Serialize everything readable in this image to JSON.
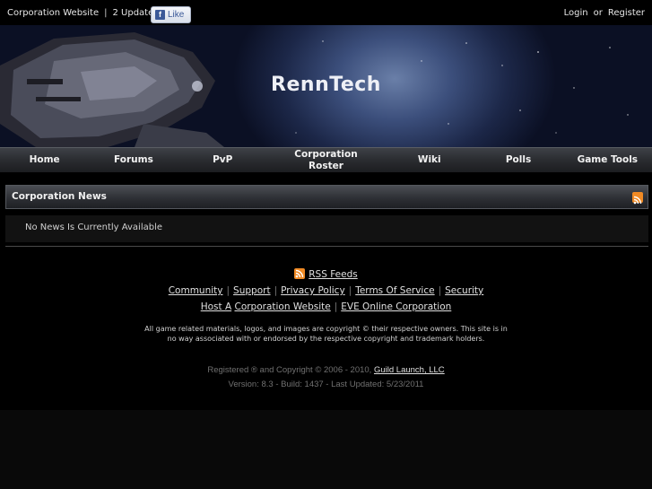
{
  "topbar": {
    "corp_website": "Corporation Website",
    "separator": "|",
    "updates": "2 Updates",
    "fb_like": "Like",
    "fb_icon_glyph": "f",
    "login": "Login",
    "or": "or",
    "register": "Register"
  },
  "banner": {
    "title": "RennTech"
  },
  "nav": {
    "items": [
      {
        "label": "Home"
      },
      {
        "label": "Forums"
      },
      {
        "label": "PvP"
      },
      {
        "label": "Corporation Roster"
      },
      {
        "label": "Wiki"
      },
      {
        "label": "Polls"
      },
      {
        "label": "Game Tools"
      }
    ]
  },
  "news": {
    "title": "Corporation News",
    "empty_message": "No News Is Currently Available"
  },
  "footer": {
    "rss_feeds": "RSS Feeds",
    "links_row1": [
      "Community",
      "Support",
      "Privacy Policy",
      "Terms Of Service",
      "Security"
    ],
    "host_a": "Host A",
    "corp_website": "Corporation Website",
    "eve_corp": "EVE Online Corporation",
    "copyright_notice": "All game related materials, logos, and images are copyright © their respective owners. This site is in no way associated with or endorsed by the respective copyright and trademark holders.",
    "registered_prefix": "Registered ® and Copyright © 2006 - 2010,",
    "guild_launch": "Guild Launch, LLC",
    "version": "Version: 8.3 - Build: 1437 - Last Updated: 5/23/2011"
  },
  "colors": {
    "rss": "#f08a24",
    "fb_blue": "#3b5998"
  }
}
